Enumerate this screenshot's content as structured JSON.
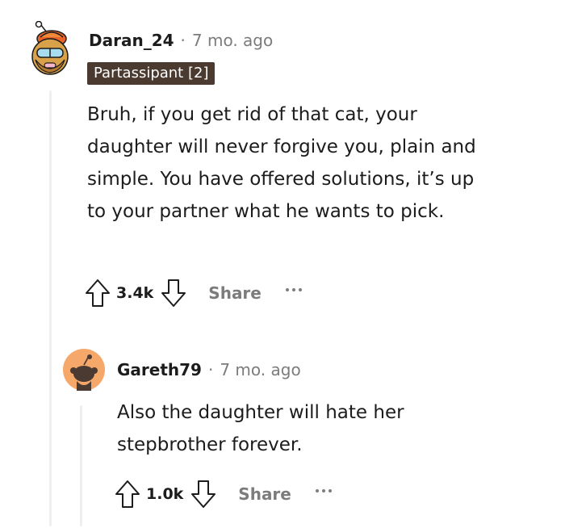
{
  "comment1": {
    "username": "Daran_24",
    "separator": "·",
    "time": "7 mo. ago",
    "flair": "Partassipant [2]",
    "body": "Bruh, if you get rid of that cat, your daughter will never forgive you, plain and simple. You have offered solutions, it’s up to your partner what he wants to pick.",
    "score": "3.4k",
    "share_label": "Share"
  },
  "comment2": {
    "username": "Gareth79",
    "separator": "·",
    "time": "7 mo. ago",
    "body": "Also the daughter will hate her stepbrother forever.",
    "score": "1.0k",
    "share_label": "Share"
  },
  "colors": {
    "flair_bg": "#4b3a30",
    "avatar2_bg": "#f6a86b",
    "thread_line": "#edeff1",
    "muted_text": "#7c7c7c"
  }
}
